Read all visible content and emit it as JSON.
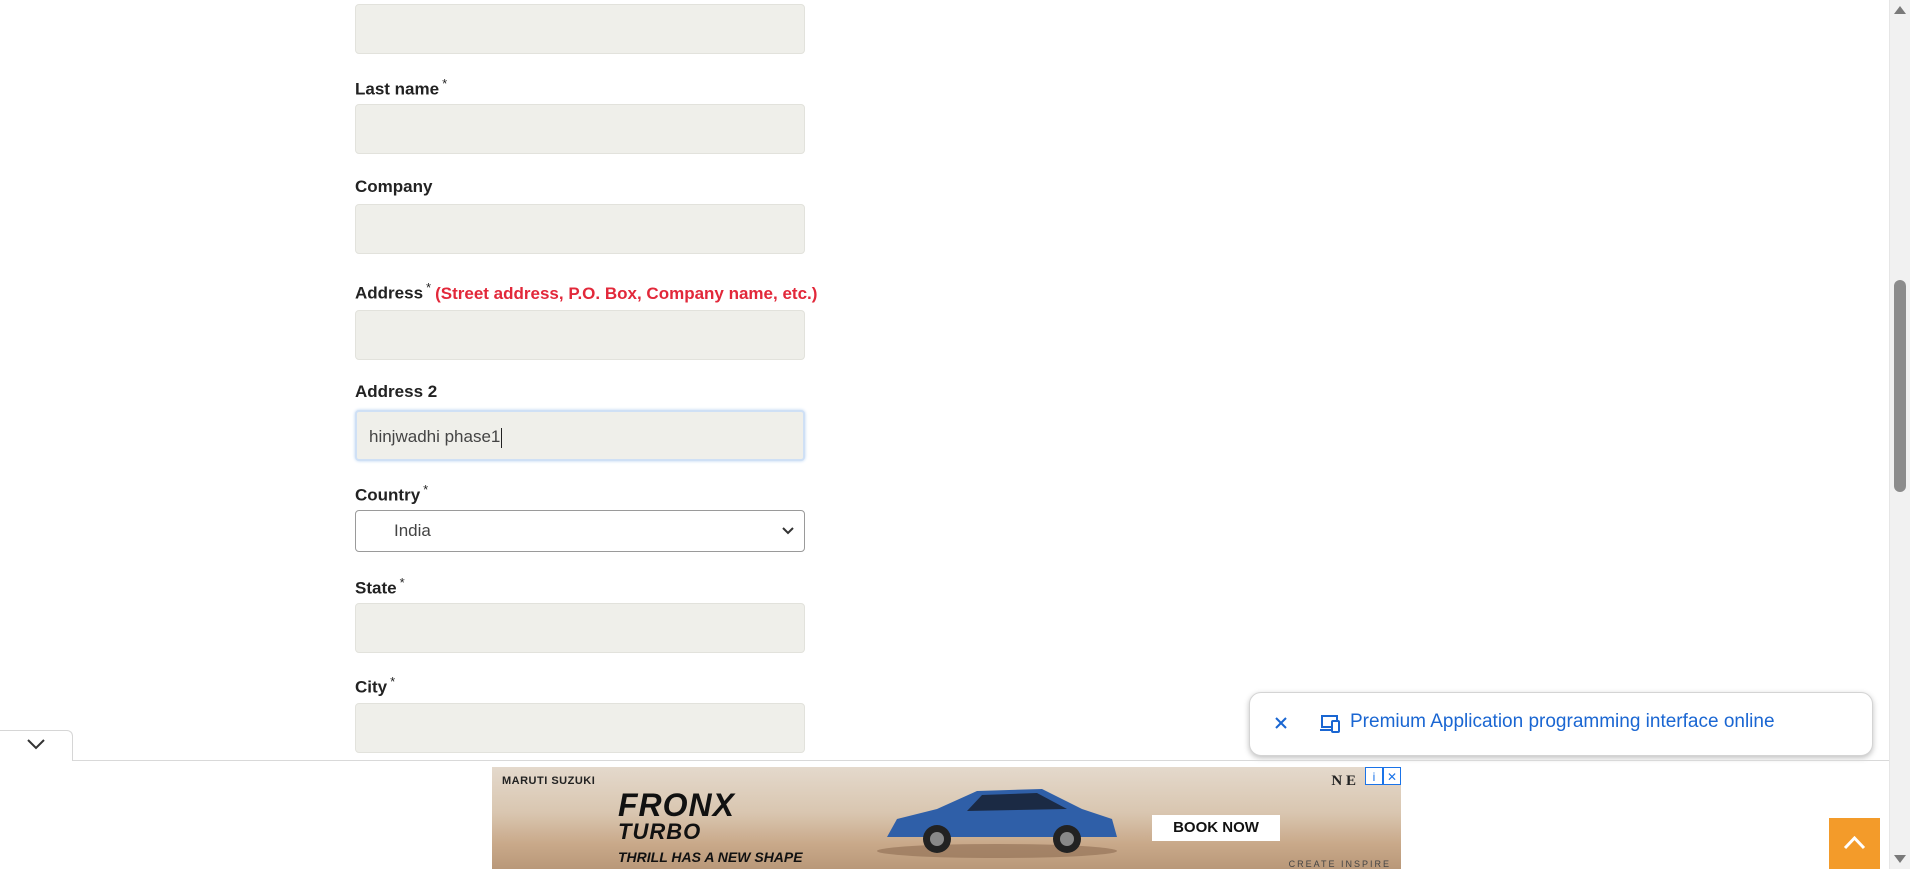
{
  "form": {
    "first_name_value": "",
    "last_name": {
      "label": "Last name",
      "required_mark": "*",
      "value": ""
    },
    "company": {
      "label": "Company",
      "value": ""
    },
    "address": {
      "label": "Address",
      "required_mark": "*",
      "hint": "(Street address, P.O. Box, Company name, etc.)",
      "value": ""
    },
    "address2": {
      "label": "Address 2",
      "value": "hinjwadhi phase1"
    },
    "country": {
      "label": "Country",
      "required_mark": "*",
      "selected": "India"
    },
    "state": {
      "label": "State",
      "required_mark": "*",
      "value": ""
    },
    "city": {
      "label": "City",
      "required_mark": "*",
      "value": ""
    }
  },
  "popup": {
    "text": "Premium Application programming interface online"
  },
  "ad": {
    "brand": "MARUTI SUZUKI",
    "headline": "FRONX",
    "subheadline": "TURBO",
    "tagline": "THRILL HAS A NEW SHAPE",
    "cta": "BOOK NOW",
    "corner_text": "N E",
    "footer_text": "CREATE INSPIRE"
  },
  "colors": {
    "hint_red": "#e2283a",
    "link_blue": "#1a66d2",
    "scroll_top_orange": "#f39b2a",
    "input_bg": "#efefea"
  },
  "icons": {
    "popup_close": "close-icon",
    "popup_devices": "devices-icon",
    "collapse": "chevron-down-icon",
    "scroll_top": "chevron-up-icon",
    "ad_info": "info-icon",
    "ad_close": "close-icon"
  }
}
